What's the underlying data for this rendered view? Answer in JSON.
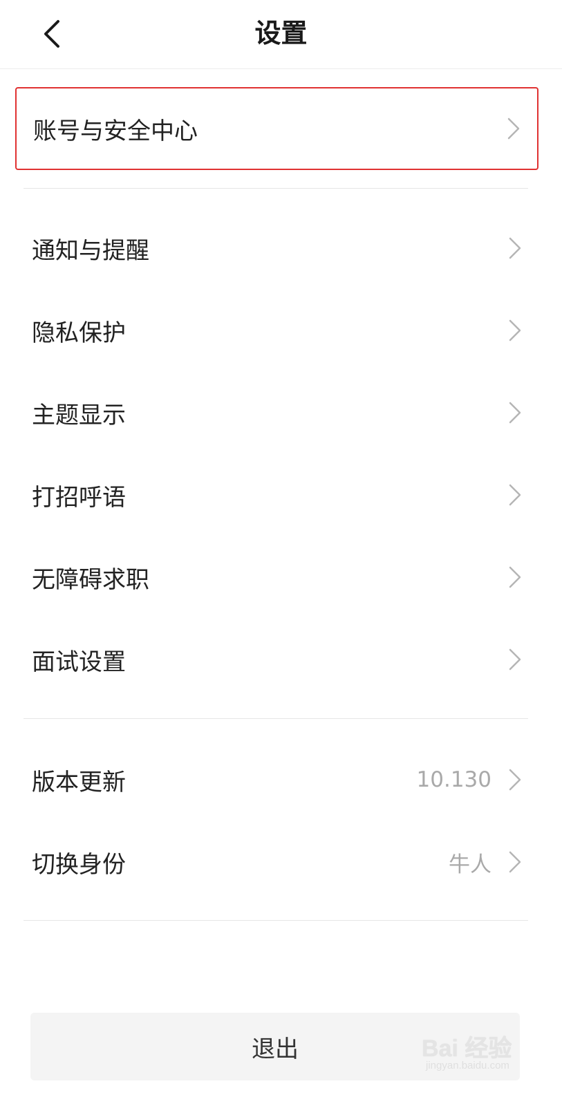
{
  "header": {
    "title": "设置",
    "back_icon": "chevron-left-icon"
  },
  "sections": [
    {
      "items": [
        {
          "label": "账号与安全中心",
          "value": "",
          "highlighted": true
        }
      ]
    },
    {
      "items": [
        {
          "label": "通知与提醒",
          "value": ""
        },
        {
          "label": "隐私保护",
          "value": ""
        },
        {
          "label": "主题显示",
          "value": ""
        },
        {
          "label": "打招呼语",
          "value": ""
        },
        {
          "label": "无障碍求职",
          "value": ""
        },
        {
          "label": "面试设置",
          "value": ""
        }
      ]
    },
    {
      "items": [
        {
          "label": "版本更新",
          "value": "10.130"
        },
        {
          "label": "切换身份",
          "value": "牛人"
        }
      ]
    }
  ],
  "logout_label": "退出",
  "watermark": {
    "main": "Bai 经验",
    "sub": "jingyan.baidu.com"
  },
  "colors": {
    "highlight_border": "#e03131",
    "value_text": "#a9a9a9",
    "logout_bg": "#f4f4f4"
  }
}
